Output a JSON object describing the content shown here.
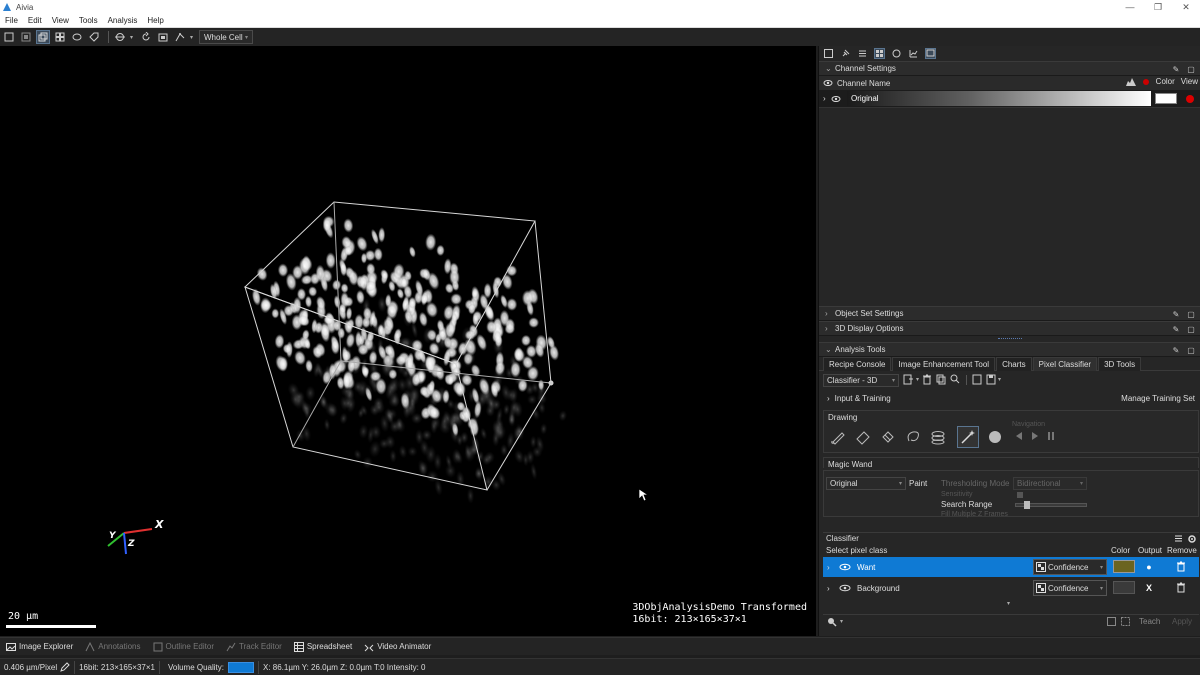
{
  "window": {
    "title": "Aivia"
  },
  "menu": [
    "File",
    "Edit",
    "View",
    "Tools",
    "Analysis",
    "Help"
  ],
  "toolbar": {
    "view_mode": "Whole Cell"
  },
  "viewer": {
    "scalebar_label": "20 µm",
    "image_name": "3DObjAnalysisDemo Transformed",
    "image_info": "16bit: 213×165×37×1",
    "axes": {
      "x": "X",
      "y": "Y",
      "z": "Z"
    },
    "colors": {
      "x_axis": "#e03030",
      "y_axis": "#30c030",
      "z_axis": "#3060ff"
    }
  },
  "right_panel": {
    "channel_settings": {
      "title": "Channel Settings",
      "col_name": "Channel Name",
      "col_color": "Color",
      "col_view": "View",
      "channels": [
        {
          "name": "Original",
          "color": "#ffffff"
        }
      ]
    },
    "object_set_settings": "Object Set Settings",
    "display_3d_options": "3D Display Options",
    "analysis_tools": {
      "title": "Analysis Tools",
      "tabs": [
        "Recipe Console",
        "Image Enhancement Tool",
        "Charts",
        "Pixel Classifier",
        "3D Tools"
      ],
      "active_tab": "Pixel Classifier",
      "classifier_mode": "Classifier - 3D",
      "input_training": "Input & Training",
      "manage_training_set": "Manage Training Set",
      "drawing_title": "Drawing",
      "navigation_label": "Navigation",
      "magic_wand": {
        "title": "Magic Wand",
        "channel": "Original",
        "paint": "Paint",
        "thresholding_mode_label": "Thresholding Mode",
        "thresholding_mode_value": "Bidirectional",
        "sensitivity": "Sensitivity",
        "search_range": "Search Range",
        "search_range_fraction": 0.12,
        "fill_multiple": "Fill Multiple Z Frames"
      },
      "classifier": {
        "title": "Classifier",
        "col_select": "Select pixel class",
        "col_color": "Color",
        "col_output": "Output",
        "col_remove": "Remove",
        "classes": [
          {
            "name": "Want",
            "output_type": "Confidence",
            "color": "#6b6420",
            "output": "●",
            "selected": true
          },
          {
            "name": "Background",
            "output_type": "Confidence",
            "color": "#3a3a3a",
            "output": "X",
            "selected": false
          }
        ]
      },
      "teach": "Teach",
      "apply": "Apply"
    }
  },
  "bottom_tabs": [
    {
      "label": "Image Explorer",
      "enabled": true
    },
    {
      "label": "Annotations",
      "enabled": false
    },
    {
      "label": "Outline Editor",
      "enabled": false
    },
    {
      "label": "Track Editor",
      "enabled": false
    },
    {
      "label": "Spreadsheet",
      "enabled": true
    },
    {
      "label": "Video Animator",
      "enabled": true
    }
  ],
  "status": {
    "pixel_size": "0.406",
    "pixel_unit": "µm/Pixel",
    "bitinfo": "16bit: 213×165×37×1",
    "volume_quality": "Volume Quality:",
    "coords": "X: 86.1µm  Y: 26.0µm  Z: 0.0µm  T:0  Intensity: 0"
  }
}
